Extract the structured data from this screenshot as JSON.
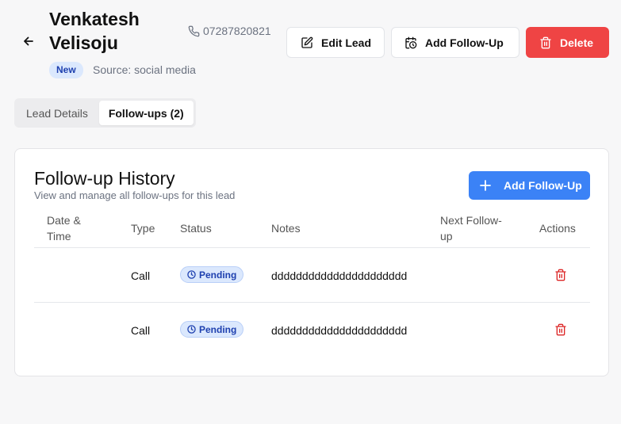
{
  "header": {
    "name": "Venkatesh Velisoju",
    "phone": "07287820821",
    "status_badge": "New",
    "source": "Source: social media",
    "edit_label": "Edit Lead",
    "follow_label": "Add Follow-Up",
    "delete_label": "Delete"
  },
  "tabs": [
    {
      "label": "Lead Details",
      "active": false
    },
    {
      "label": "Follow-ups (2)",
      "active": true
    }
  ],
  "card": {
    "title": "Follow-up History",
    "subtitle": "View and manage all follow-ups for this lead",
    "add_label": "Add Follow-Up",
    "columns": {
      "datetime": "Date & Time",
      "type": "Type",
      "status": "Status",
      "notes": "Notes",
      "next": "Next Follow-up",
      "actions": "Actions"
    },
    "rows": [
      {
        "datetime": "",
        "type": "Call",
        "status": "Pending",
        "notes": "dddddddddddddddddddddd",
        "next": ""
      },
      {
        "datetime": "",
        "type": "Call",
        "status": "Pending",
        "notes": "dddddddddddddddddddddd",
        "next": ""
      }
    ]
  },
  "colors": {
    "primary": "#3b82f6",
    "danger": "#ef4444",
    "badge_bg": "#dbe8fd",
    "badge_text": "#1e40af"
  },
  "icons": [
    "back-arrow-icon",
    "phone-icon",
    "edit-icon",
    "calendar-clock-icon",
    "trash-icon",
    "plus-icon",
    "clock-icon"
  ]
}
